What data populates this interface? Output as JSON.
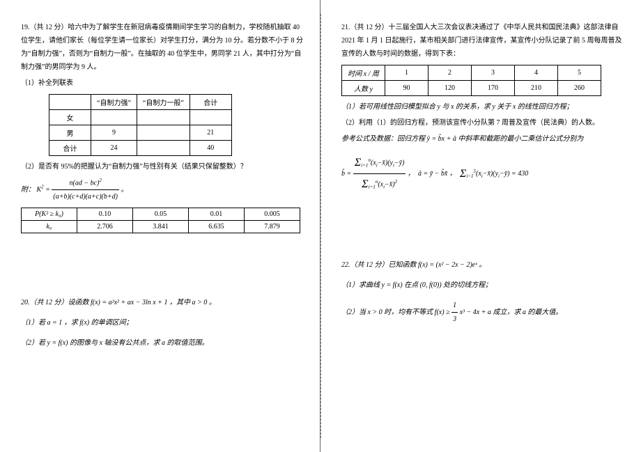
{
  "q19": {
    "heading": "19.（共 12 分）哈六中为了解学生在新冠病毒疫情期间学生学习的自制力，学校随机抽取 40 位学生，请他们家长（每位学生请一位家长）对学生打分，满分为 10 分。若分数不小于 8 分为“自制力强”，否则为“自制力一般”。在抽取的 40 位学生中，男同学 21 人，其中打分为“自制力强”的男同学为 9 人。",
    "sub1": "（1）补全列联表",
    "table1": {
      "headers": [
        "",
        "“自制力强”",
        "“自制力一般”",
        "合计"
      ],
      "rows": [
        [
          "女",
          "",
          "",
          ""
        ],
        [
          "男",
          "9",
          "",
          "21"
        ],
        [
          "合计",
          "24",
          "",
          "40"
        ]
      ]
    },
    "sub2": "（2）是否有 95%的把握认为“自制力强”与性别有关（结果只保留整数）？",
    "note": "附：",
    "table2": {
      "r1": [
        "P(K² ≥ k₀)",
        "0.10",
        "0.05",
        "0.01",
        "0.005"
      ],
      "r2": [
        "k₀",
        "2.706",
        "3.841",
        "6.635",
        "7.879"
      ]
    }
  },
  "q20": {
    "heading": "20.（共 12 分）设函数 f(x) = a²x² + ax − 3ln x + 1 ，其中 a > 0 。",
    "sub1": "（1）若 a = 1 ，求 f(x) 的单调区间；",
    "sub2": "（2）若 y = f(x) 的图像与 x 轴没有公共点，求 a 的取值范围。"
  },
  "q21": {
    "heading": "21.（共 12 分）十三届全国人大三次会议表决通过了《中华人民共和国民法典》这部法律自 2021 年 1 月 1 日起施行，某市相关部门进行法律宣传，某宣传小分队记录了前 5 周每周普及宣传的人数与时间的数据，得到下表：",
    "table": {
      "head": [
        "时间 x / 周",
        "1",
        "2",
        "3",
        "4",
        "5"
      ],
      "row": [
        "人数 y",
        "90",
        "120",
        "170",
        "210",
        "260"
      ]
    },
    "sub1": "（1）若可用线性回归模型拟合 y 与 x 的关系，求 y 关于 x 的线性回归方程；",
    "sub2": "（2）利用（1）的回归方程，预测该宣传小分队第 7 周普及宣传（民法典）的人数。",
    "ref": "参考公式及数据：回归方程 ŷ = b̂x + â 中斜率和截距的最小二乘估计公式分别为",
    "sumval": "430"
  },
  "q22": {
    "heading": "22.（共 12 分）已知函数 f(x) = (x² − 2x − 2)eˣ 。",
    "sub1": "（1）求曲线 y = f(x) 在点 (0, f(0)) 处的切线方程；",
    "sub2_a": "（2）当 x > 0 时，均有不等式 f(x) ≥ ",
    "sub2_b": " x³ − 4x + a 成立，求 a 的最大值。"
  }
}
